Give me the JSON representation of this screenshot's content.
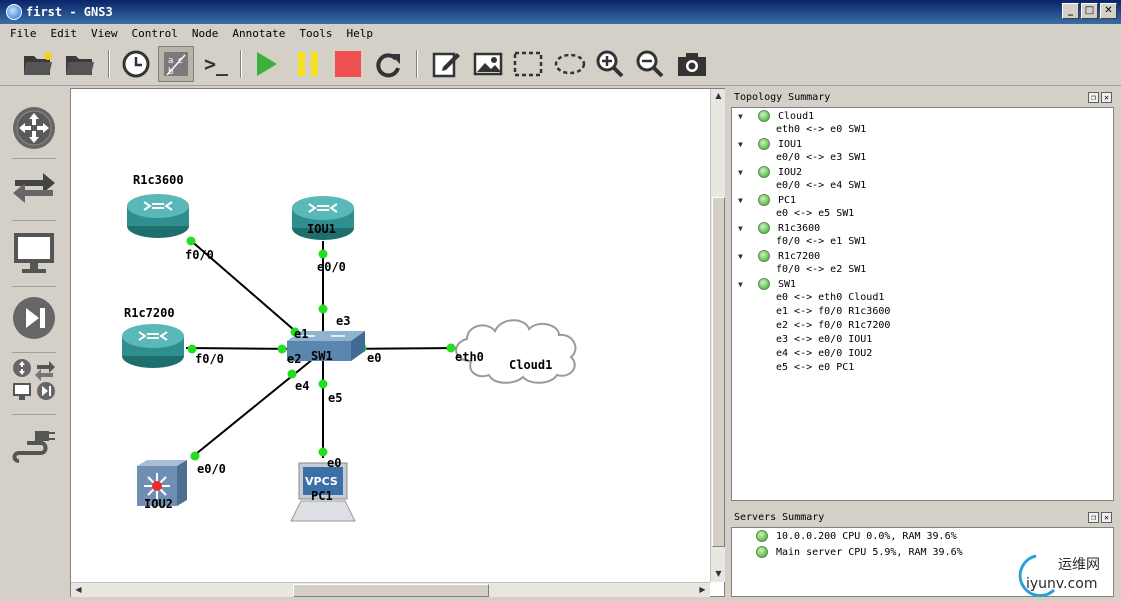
{
  "window": {
    "title": "first - GNS3",
    "controls": [
      "_",
      "□",
      "✕"
    ]
  },
  "menu": [
    "File",
    "Edit",
    "View",
    "Control",
    "Node",
    "Annotate",
    "Tools",
    "Help"
  ],
  "toolbar": {
    "icons": [
      "open-folder-new-icon",
      "open-folder-icon",
      "clock-icon",
      "show-interface-labels-icon",
      "console-icon",
      "start-icon",
      "pause-icon",
      "stop-icon",
      "reload-icon",
      "edit-note-icon",
      "insert-image-icon",
      "draw-rectangle-icon",
      "draw-ellipse-icon",
      "zoom-in-icon",
      "zoom-out-icon",
      "screenshot-icon"
    ],
    "console_glyph": ">_"
  },
  "topology": {
    "nodes": {
      "r1c3600": "R1c3600",
      "iou1": "IOU1",
      "r1c7200": "R1c7200",
      "sw1": "SW1",
      "cloud1": "Cloud1",
      "iou2": "IOU2",
      "pc1": "PC1",
      "vpcs_badge": "VPCS"
    },
    "ports": {
      "r1c3600_f00": "f0/0",
      "iou1_e00": "e0/0",
      "r1c7200_f00": "f0/0",
      "sw1_e1": "e1",
      "sw1_e3": "e3",
      "sw1_e2": "e2",
      "sw1_e0": "e0",
      "sw1_e4": "e4",
      "sw1_e5": "e5",
      "cloud1_eth0": "eth0",
      "iou2_e00": "e0/0",
      "pc1_e0": "e0"
    }
  },
  "topology_summary": {
    "title": "Topology Summary",
    "items": [
      {
        "name": "Cloud1",
        "links": [
          "eth0 <-> e0 SW1"
        ]
      },
      {
        "name": "IOU1",
        "links": [
          "e0/0 <-> e3 SW1"
        ]
      },
      {
        "name": "IOU2",
        "links": [
          "e0/0 <-> e4 SW1"
        ]
      },
      {
        "name": "PC1",
        "links": [
          "e0 <-> e5 SW1"
        ]
      },
      {
        "name": "R1c3600",
        "links": [
          "f0/0 <-> e1 SW1"
        ]
      },
      {
        "name": "R1c7200",
        "links": [
          "f0/0 <-> e2 SW1"
        ]
      },
      {
        "name": "SW1",
        "links": [
          "e0 <-> eth0 Cloud1",
          "e1 <-> f0/0 R1c3600",
          "e2 <-> f0/0 R1c7200",
          "e3 <-> e0/0 IOU1",
          "e4 <-> e0/0 IOU2",
          "e5 <-> e0 PC1"
        ]
      }
    ]
  },
  "servers_summary": {
    "title": "Servers Summary",
    "items": [
      "10.0.0.200 CPU 0.0%, RAM 39.6%",
      "Main server CPU 5.9%, RAM 39.6%"
    ]
  },
  "watermark": {
    "cn": "运维网",
    "url": "iyunv.com"
  },
  "colors": {
    "link_dot": "#22dd22",
    "router": "#2f8f8f",
    "title_bg": "#0a246a"
  }
}
